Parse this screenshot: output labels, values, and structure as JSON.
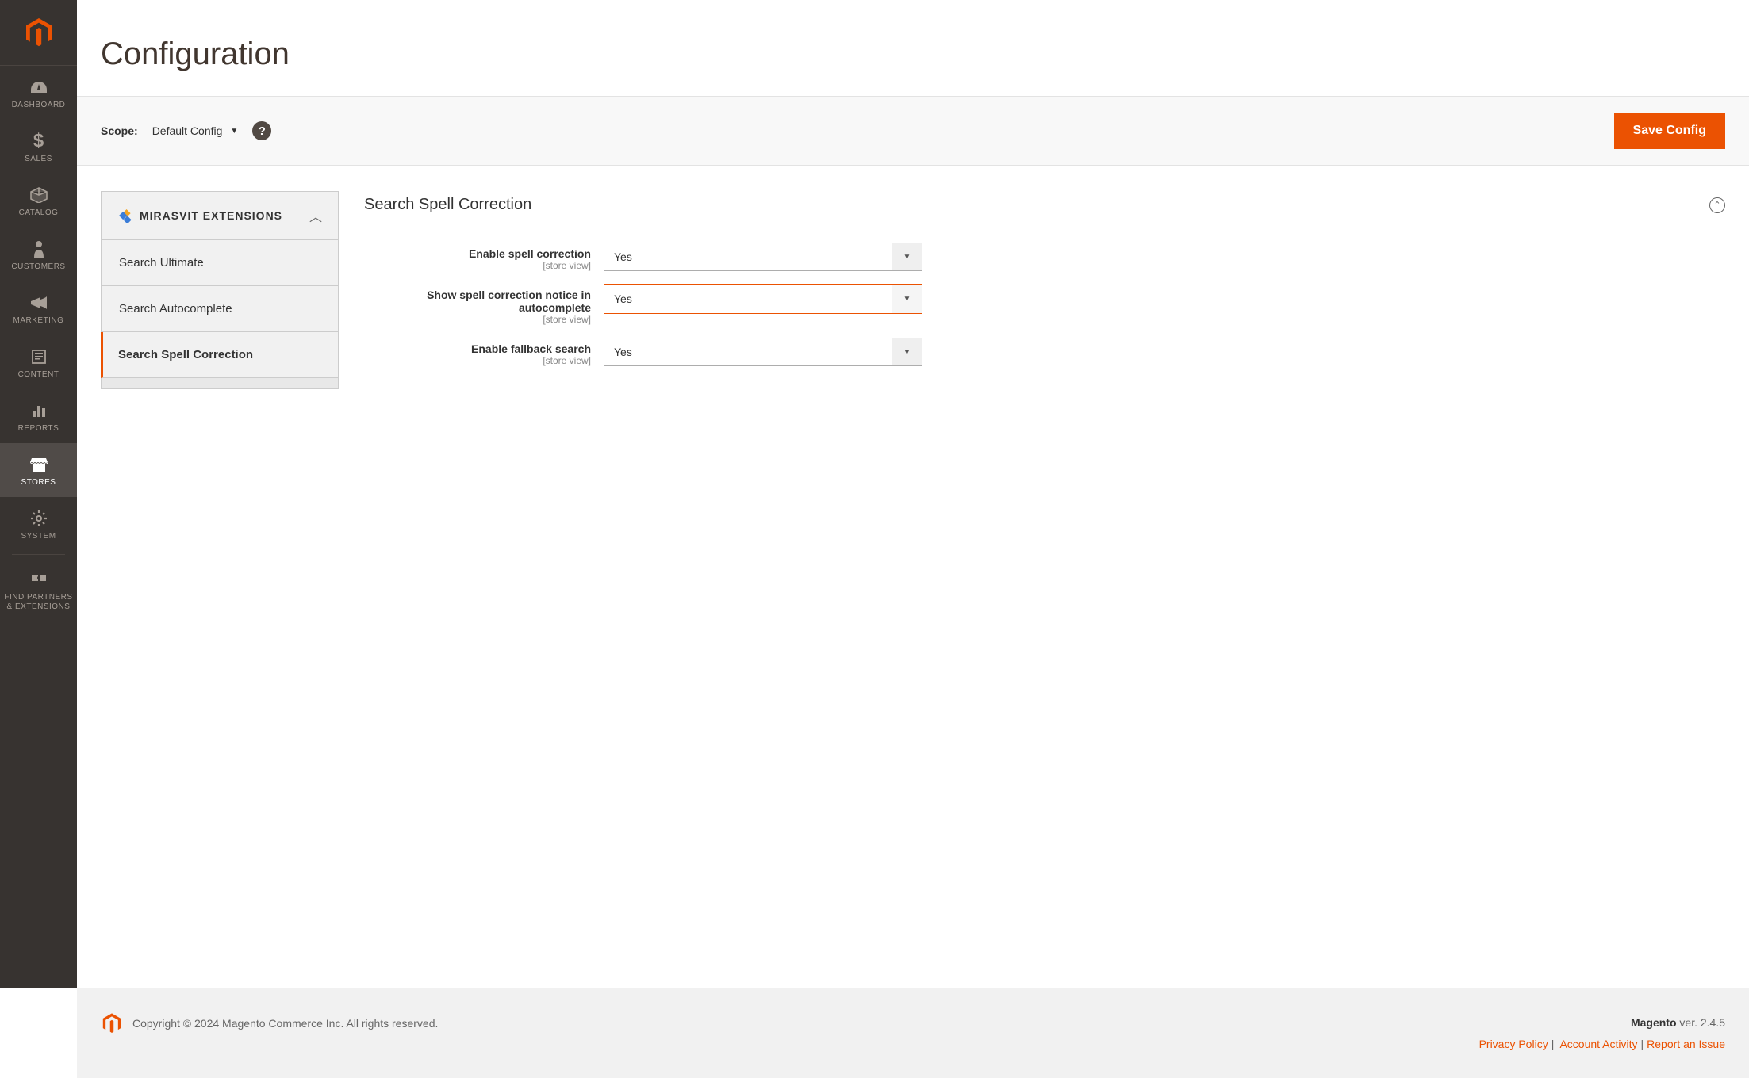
{
  "sidebar": {
    "items": [
      {
        "label": "DASHBOARD"
      },
      {
        "label": "SALES"
      },
      {
        "label": "CATALOG"
      },
      {
        "label": "CUSTOMERS"
      },
      {
        "label": "MARKETING"
      },
      {
        "label": "CONTENT"
      },
      {
        "label": "REPORTS"
      },
      {
        "label": "STORES"
      },
      {
        "label": "SYSTEM"
      },
      {
        "label": "FIND PARTNERS & EXTENSIONS"
      }
    ]
  },
  "page": {
    "title": "Configuration"
  },
  "toolbar": {
    "scope_label": "Scope:",
    "scope_value": "Default Config",
    "help": "?",
    "save_label": "Save Config"
  },
  "config_tabs": {
    "group_title": "MIRASVIT EXTENSIONS",
    "items": [
      {
        "label": "Search Ultimate"
      },
      {
        "label": "Search Autocomplete"
      },
      {
        "label": "Search Spell Correction"
      }
    ]
  },
  "section": {
    "title": "Search Spell Correction",
    "fields": [
      {
        "label": "Enable spell correction",
        "scope": "[store view]",
        "value": "Yes"
      },
      {
        "label": "Show spell correction notice in autocomplete",
        "scope": "[store view]",
        "value": "Yes"
      },
      {
        "label": "Enable fallback search",
        "scope": "[store view]",
        "value": "Yes"
      }
    ]
  },
  "footer": {
    "copyright": "Copyright © 2024 Magento Commerce Inc. All rights reserved.",
    "brand": "Magento",
    "version": " ver. 2.4.5",
    "links": {
      "privacy": "Privacy Policy",
      "activity": " Account Activity",
      "report": "Report an Issue"
    }
  }
}
